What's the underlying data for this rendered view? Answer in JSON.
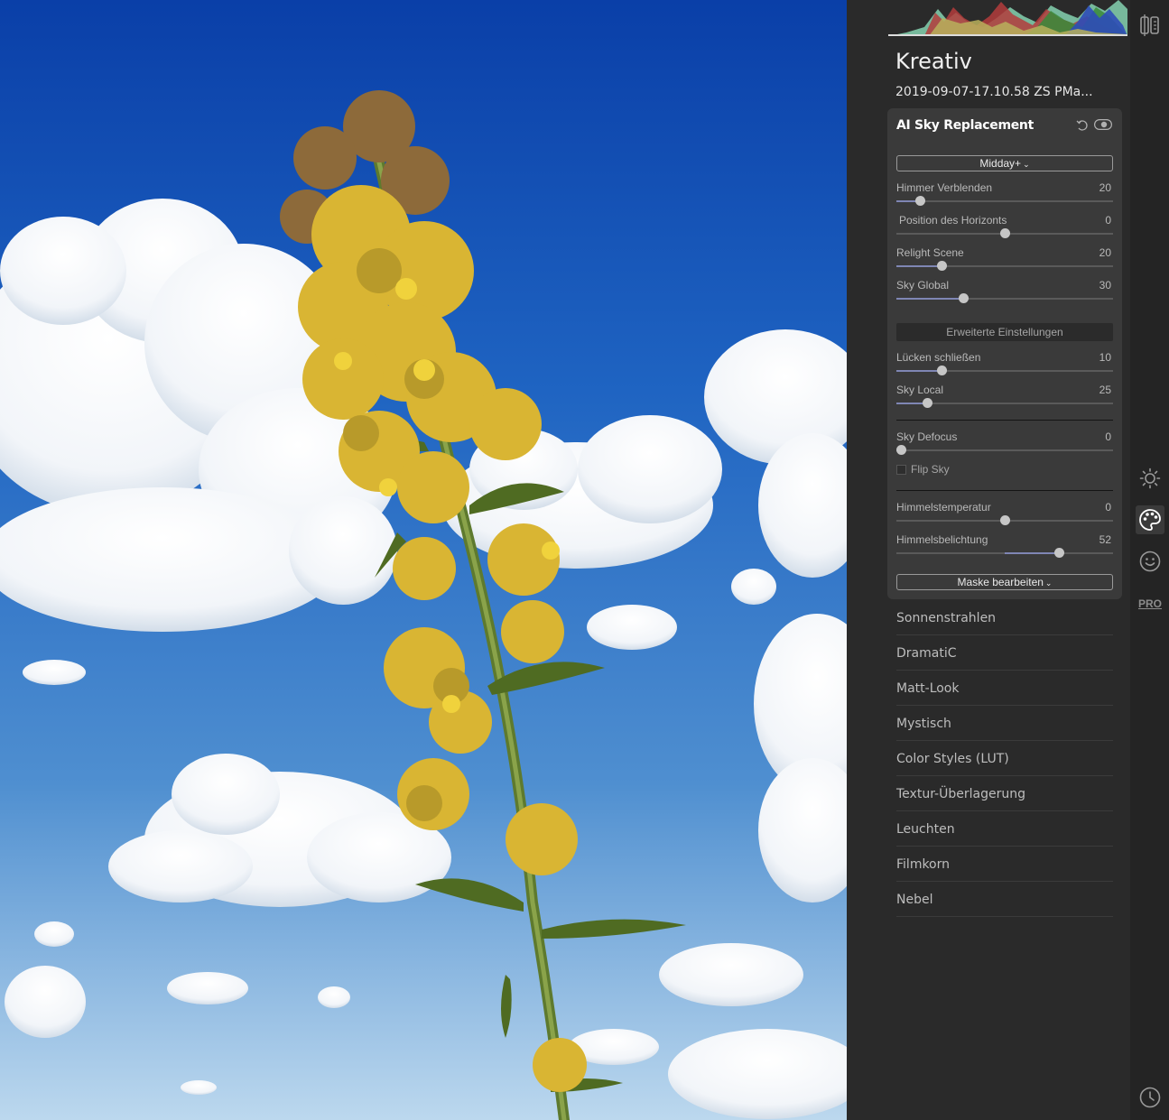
{
  "panel": {
    "title": "Kreativ",
    "file_name": "2019-09-07-17.10.58 ZS PMa..."
  },
  "filter_card": {
    "title": "AI Sky Replacement",
    "preset": "Midday+",
    "advanced_label": "Erweiterte Einstellungen",
    "flip_label": "Flip Sky",
    "flip_checked": false,
    "mask_label": "Maske bearbeiten",
    "sliders": [
      {
        "label": "Himmer Verblenden",
        "value": "20",
        "level": 0.11
      },
      {
        "label": "Position des Horizonts",
        "value": "0",
        "level": 0.5
      },
      {
        "label": "Relight Scene",
        "value": "20",
        "level": 0.21
      },
      {
        "label": "Sky Global",
        "value": "30",
        "level": 0.31
      },
      {
        "label": "Lücken schließen",
        "value": "10",
        "level": 0.21
      },
      {
        "label": "Sky Local",
        "value": "25",
        "level": 0.14
      },
      {
        "label": "Sky Defocus",
        "value": "0",
        "level": 0.02
      },
      {
        "label": "Himmelstemperatur",
        "value": "0",
        "level": 0.5
      },
      {
        "label": "Himmelsbelichtung",
        "value": "52",
        "level": 0.75
      }
    ]
  },
  "filters": [
    "Sonnenstrahlen",
    "DramatiC",
    "Matt-Look",
    "Mystisch",
    "Color Styles (LUT)",
    "Textur-Überlagerung",
    "Leuchten",
    "Filmkorn",
    "Nebel"
  ],
  "toolbar": {
    "pro_label": "PRO",
    "icons": [
      "compare-icon",
      "sun-icon",
      "palette-icon",
      "smiley-icon",
      "history-icon"
    ]
  },
  "colors": {
    "accent": "#7f86b4",
    "panel_bg": "#2a2a2a",
    "card_bg": "#3a3a3a",
    "sky_top": "#0a3fa8",
    "sky_bottom": "#bcd8ee"
  }
}
